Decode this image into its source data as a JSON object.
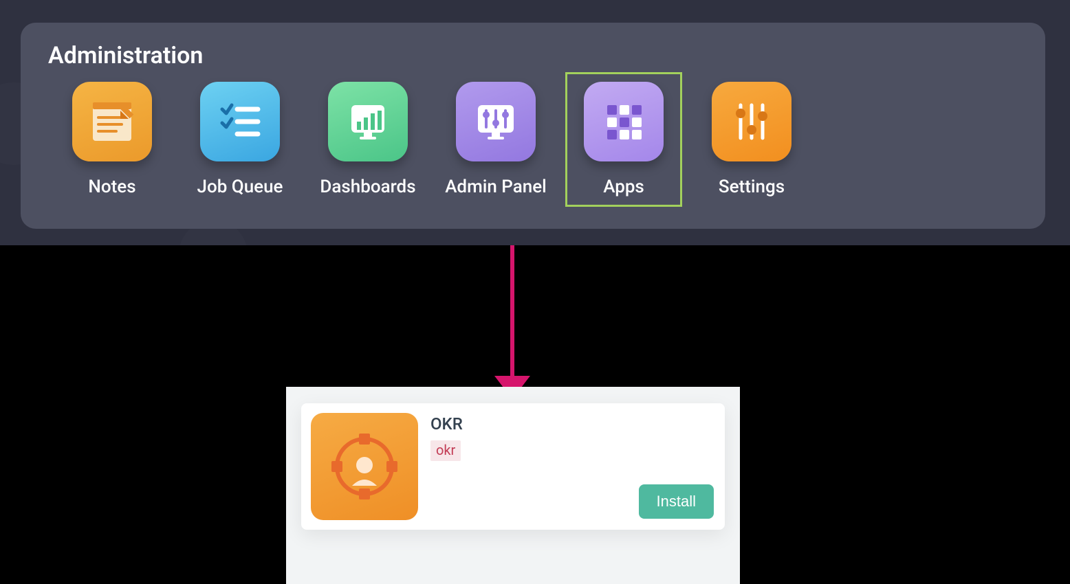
{
  "admin": {
    "title": "Administration",
    "tiles": [
      {
        "id": "notes",
        "label": "Notes",
        "icon": "notes-icon",
        "selected": false
      },
      {
        "id": "job-queue",
        "label": "Job Queue",
        "icon": "checklist-icon",
        "selected": false
      },
      {
        "id": "dashboards",
        "label": "Dashboards",
        "icon": "chart-icon",
        "selected": false
      },
      {
        "id": "admin-panel",
        "label": "Admin Panel",
        "icon": "sliders-panel-icon",
        "selected": false
      },
      {
        "id": "apps",
        "label": "Apps",
        "icon": "grid-icon",
        "selected": true
      },
      {
        "id": "settings",
        "label": "Settings",
        "icon": "sliders-icon",
        "selected": false
      }
    ]
  },
  "app_card": {
    "title": "OKR",
    "tag": "okr",
    "install_label": "Install",
    "icon": "okr-icon"
  },
  "colors": {
    "highlight_border": "#a3d15c",
    "arrow": "#d6156c",
    "install_button": "#4fb99f"
  }
}
